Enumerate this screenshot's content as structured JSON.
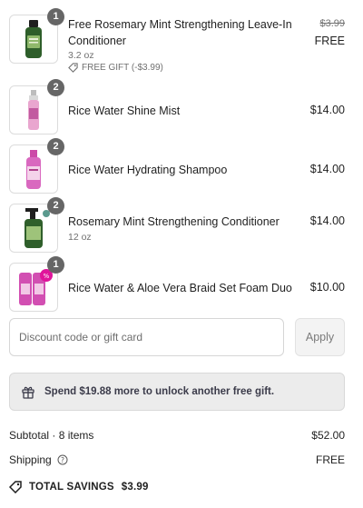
{
  "cart": {
    "items": [
      {
        "title": "Free Rosemary Mint Strengthening Leave-In Conditioner",
        "variant": "3.2 oz",
        "gift_label": "FREE GIFT (-$3.99)",
        "original_price": "$3.99",
        "price": "FREE",
        "quantity": "1",
        "icon": "bottle-green-icon"
      },
      {
        "title": "Rice Water Shine Mist",
        "variant": "",
        "price": "$14.00",
        "quantity": "2",
        "icon": "spray-bottle-pink-icon"
      },
      {
        "title": "Rice Water Hydrating Shampoo",
        "variant": "",
        "price": "$14.00",
        "quantity": "2",
        "icon": "bottle-pink-icon"
      },
      {
        "title": "Rosemary Mint Strengthening Conditioner",
        "variant": "12 oz",
        "price": "$14.00",
        "quantity": "2",
        "icon": "pump-bottle-green-icon"
      },
      {
        "title": "Rice Water & Aloe Vera Braid Set Foam Duo",
        "variant": "",
        "price": "$10.00",
        "quantity": "1",
        "icon": "foam-duo-pink-icon"
      }
    ]
  },
  "discount": {
    "placeholder": "Discount code or gift card",
    "value": "",
    "apply_label": "Apply"
  },
  "gift_banner": {
    "text": "Spend $19.88 more to unlock another free gift."
  },
  "summary": {
    "subtotal_label": "Subtotal · 8 items",
    "subtotal_value": "$52.00",
    "shipping_label": "Shipping",
    "shipping_value": "FREE",
    "savings_label": "TOTAL SAVINGS",
    "savings_value": "$3.99"
  },
  "colors": {
    "badge": "#666666",
    "banner_bg": "#ececec",
    "text": "#1f1f1f",
    "muted": "#707070"
  }
}
